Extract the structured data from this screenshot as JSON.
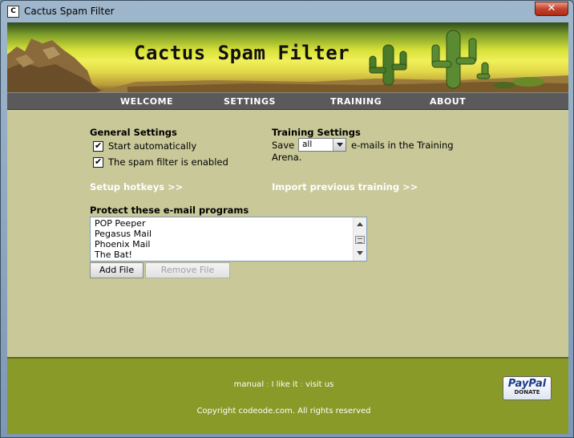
{
  "window": {
    "title": "Cactus Spam Filter",
    "close_glyph": "✕"
  },
  "banner": {
    "title": "Cactus Spam Filter"
  },
  "nav": {
    "items": [
      "WELCOME",
      "SETTINGS",
      "TRAINING",
      "ABOUT"
    ]
  },
  "general": {
    "title": "General Settings",
    "start_automatically": "Start automatically",
    "filter_enabled": "The spam filter is enabled"
  },
  "training": {
    "title": "Training Settings",
    "save_label": "Save",
    "save_value": "all",
    "after_select": "e-mails in the Training",
    "after_select_line2": "Arena."
  },
  "links": {
    "setup_hotkeys": "Setup hotkeys >>",
    "import_training": "Import previous training >>"
  },
  "programs": {
    "title": "Protect these e-mail programs",
    "items": [
      "POP Peeper",
      "Pegasus Mail",
      "Phoenix Mail",
      "The Bat!"
    ],
    "add_button": "Add File",
    "remove_button": "Remove File"
  },
  "footer": {
    "links": [
      "manual",
      "I like it",
      "visit us"
    ],
    "separator": ":",
    "copyright": "Copyright codeode.com. All rights reserved"
  },
  "paypal": {
    "logo": "PayPal",
    "sub": "DONATE"
  },
  "colors": {
    "content_bg": "#c8c899",
    "footer_bg": "#8a9a28",
    "nav_bg": "#5a5a5a"
  }
}
